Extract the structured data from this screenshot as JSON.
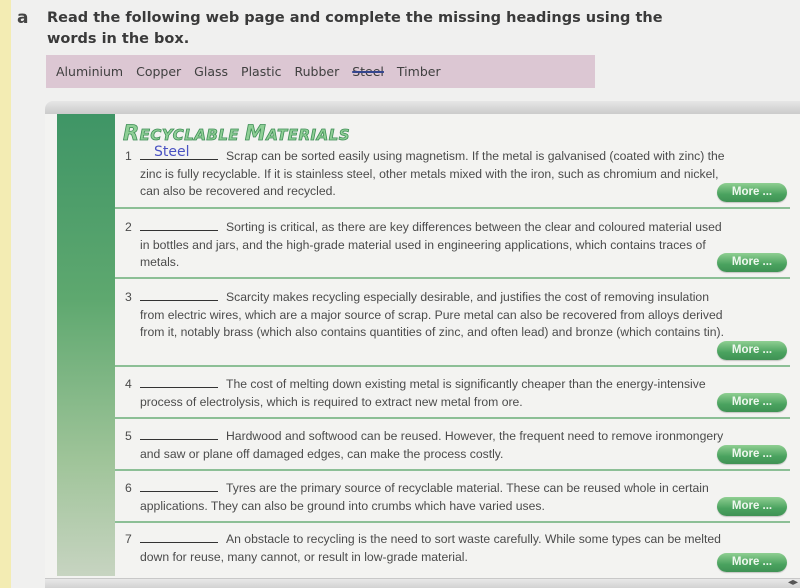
{
  "exercise": {
    "letter": "a",
    "instruction": "Read the following web page and complete the missing headings using the words in the box."
  },
  "word_box": {
    "words": [
      {
        "text": "Aluminium",
        "used": false
      },
      {
        "text": "Copper",
        "used": false
      },
      {
        "text": "Glass",
        "used": false
      },
      {
        "text": "Plastic",
        "used": false
      },
      {
        "text": "Rubber",
        "used": false
      },
      {
        "text": "Steel",
        "used": true
      },
      {
        "text": "Timber",
        "used": false
      }
    ]
  },
  "web_page": {
    "title_cap1": "R",
    "title_rest1": "ECYCLABLE ",
    "title_cap2": "M",
    "title_rest2": "ATERIALS",
    "more_label": "More ...",
    "entries": [
      {
        "number": "1",
        "answer": "Steel",
        "text": "Scrap can be sorted easily using magnetism. If the metal is galvanised (coated with zinc) the zinc is fully recyclable. If it is stainless steel, other metals mixed with the iron, such as chromium and nickel, can also be recovered and recycled."
      },
      {
        "number": "2",
        "answer": "",
        "text": "Sorting is critical, as there are key differences between the clear and coloured material used in bottles and jars, and the high-grade material used in engineering applications, which contains traces of metals."
      },
      {
        "number": "3",
        "answer": "",
        "text": "Scarcity makes recycling especially desirable, and justifies the cost of removing insulation from electric wires, which are a major source of scrap. Pure metal can also be recovered from alloys derived from it, notably brass (which also contains quantities of zinc, and often lead) and bronze (which contains tin)."
      },
      {
        "number": "4",
        "answer": "",
        "text": "The cost of melting down existing metal is significantly cheaper than the energy-intensive process of electrolysis, which is required to extract new metal from ore."
      },
      {
        "number": "5",
        "answer": "",
        "text": "Hardwood and softwood can be reused. However, the frequent need to remove ironmongery and saw or plane off damaged edges, can make the process costly."
      },
      {
        "number": "6",
        "answer": "",
        "text": "Tyres are the primary source of recyclable material. These can be reused whole in certain applications. They can also be ground into crumbs which have varied uses."
      },
      {
        "number": "7",
        "answer": "",
        "text": "An obstacle to recycling is the need to sort waste carefully. While some types can be melted down for reuse, many cannot, or result in low-grade material."
      }
    ]
  },
  "colors": {
    "accent_green": "#4aa25f",
    "wordbox_bg": "#dcc7d3",
    "handwriting_blue": "#4a52c2"
  }
}
